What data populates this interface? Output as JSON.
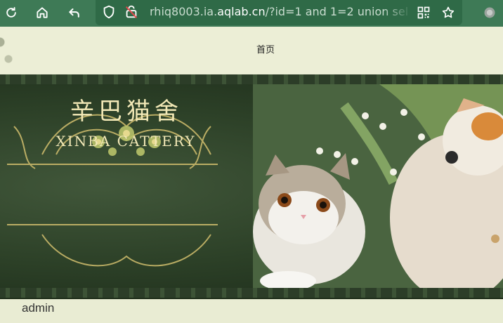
{
  "browser": {
    "url_prefix": "rhiq8003.ia.",
    "url_host": "aqlab.cn",
    "url_suffix": "/?id=1 and 1=2 union sel",
    "icons": {
      "reload": "reload-icon",
      "home": "home-icon",
      "back": "back-icon",
      "shield": "shield-icon",
      "insecure_lock": "insecure-lock-icon",
      "qr": "qr-code-icon",
      "star": "star-icon",
      "extension": "extension-icon"
    },
    "colors": {
      "toolbar": "#3e7a56",
      "urlbar": "#2f6a47"
    }
  },
  "page": {
    "nav_home": "首页",
    "banner": {
      "title_cn": "辛巴猫舍",
      "title_en": "XINBA CATTERY"
    },
    "footer_user": "admin"
  }
}
